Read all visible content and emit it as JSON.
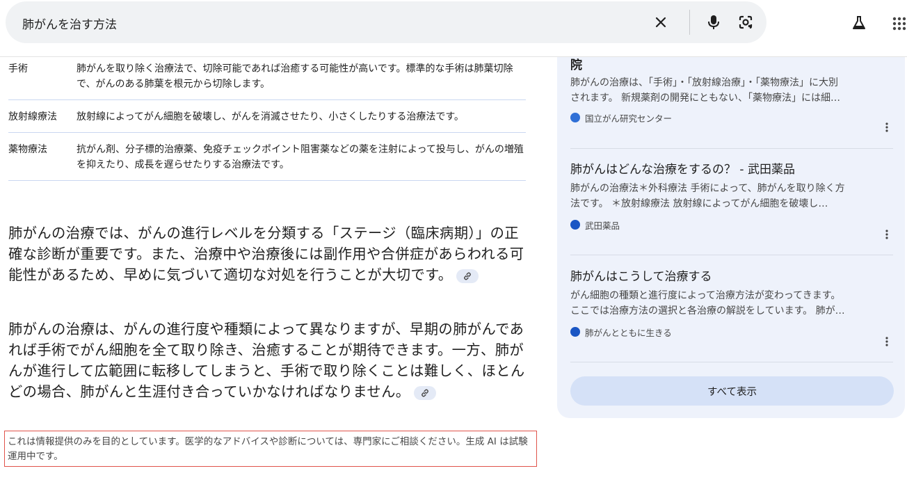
{
  "search": {
    "query": "肺がんを治す方法",
    "clear_icon": "close-icon",
    "mic_icon": "mic-icon",
    "lens_icon": "lens-icon",
    "labs_icon": "flask-icon",
    "apps_icon": "apps-grid-icon"
  },
  "table": {
    "rows": [
      {
        "term": "手術",
        "desc": "肺がんを取り除く治療法で、切除可能であれば治癒する可能性が高いです。標準的な手術は肺葉切除で、がんのある肺葉を根元から切除します。"
      },
      {
        "term": "放射線療法",
        "desc": "放射線によってがん細胞を破壊し、がんを消滅させたり、小さくしたりする治療法です。"
      },
      {
        "term": "薬物療法",
        "desc": "抗がん剤、分子標的治療薬、免疫チェックポイント阻害薬などの薬を注射によって投与し、がんの増殖を抑えたり、成長を遅らせたりする治療法です。"
      }
    ]
  },
  "paragraphs": [
    "肺がんの治療では、がんの進行レベルを分類する「ステージ（臨床病期）」の正確な診断が重要です。また、治療中や治療後には副作用や合併症があらわれる可能性があるため、早めに気づいて適切な対処を行うことが大切です。",
    "肺がんの治療は、がんの進行度や種類によって異なりますが、早期の肺がんであれば手術でがん細胞を全て取り除き、治癒することが期待できます。一方、肺がんが進行して広範囲に転移してしまうと、手術で取り除くことは難しく、ほとんどの場合、肺がんと生涯付き合っていかなければなりません。"
  ],
  "disclaimer": "これは情報提供のみを目的としています。医学的なアドバイスや診断については、専門家にご相談ください。生成 AI は試験運用中です。",
  "sources": [
    {
      "title": "院",
      "snippet1": "肺がんの治療は、「手術」・「放射線治療」・「薬物療法」に大別",
      "snippet2": "されます。 新規薬剤の開発にともない、「薬物療法」には細…",
      "site": "国立がん研究センター",
      "favicon_color": "#2f6fd6"
    },
    {
      "title": "肺がんはどんな治療をするの？ - 武田薬品",
      "snippet1": "肺がんの治療法＊外科療法 手術によって、肺がんを取り除く方",
      "snippet2": "法です。 ＊放射線療法 放射線によってがん細胞を破壊し…",
      "site": "武田薬品",
      "favicon_color": "#1a56c4"
    },
    {
      "title": "肺がんはこうして治療する",
      "snippet1": "がん細胞の種類と進行度によって治療方法が変わってきます。",
      "snippet2": "ここでは治療方法の選択と各治療の解説をしています。 肺が…",
      "site": "肺がんとともに生きる",
      "favicon_color": "#1a56c4"
    }
  ],
  "show_all": "すべて表示"
}
